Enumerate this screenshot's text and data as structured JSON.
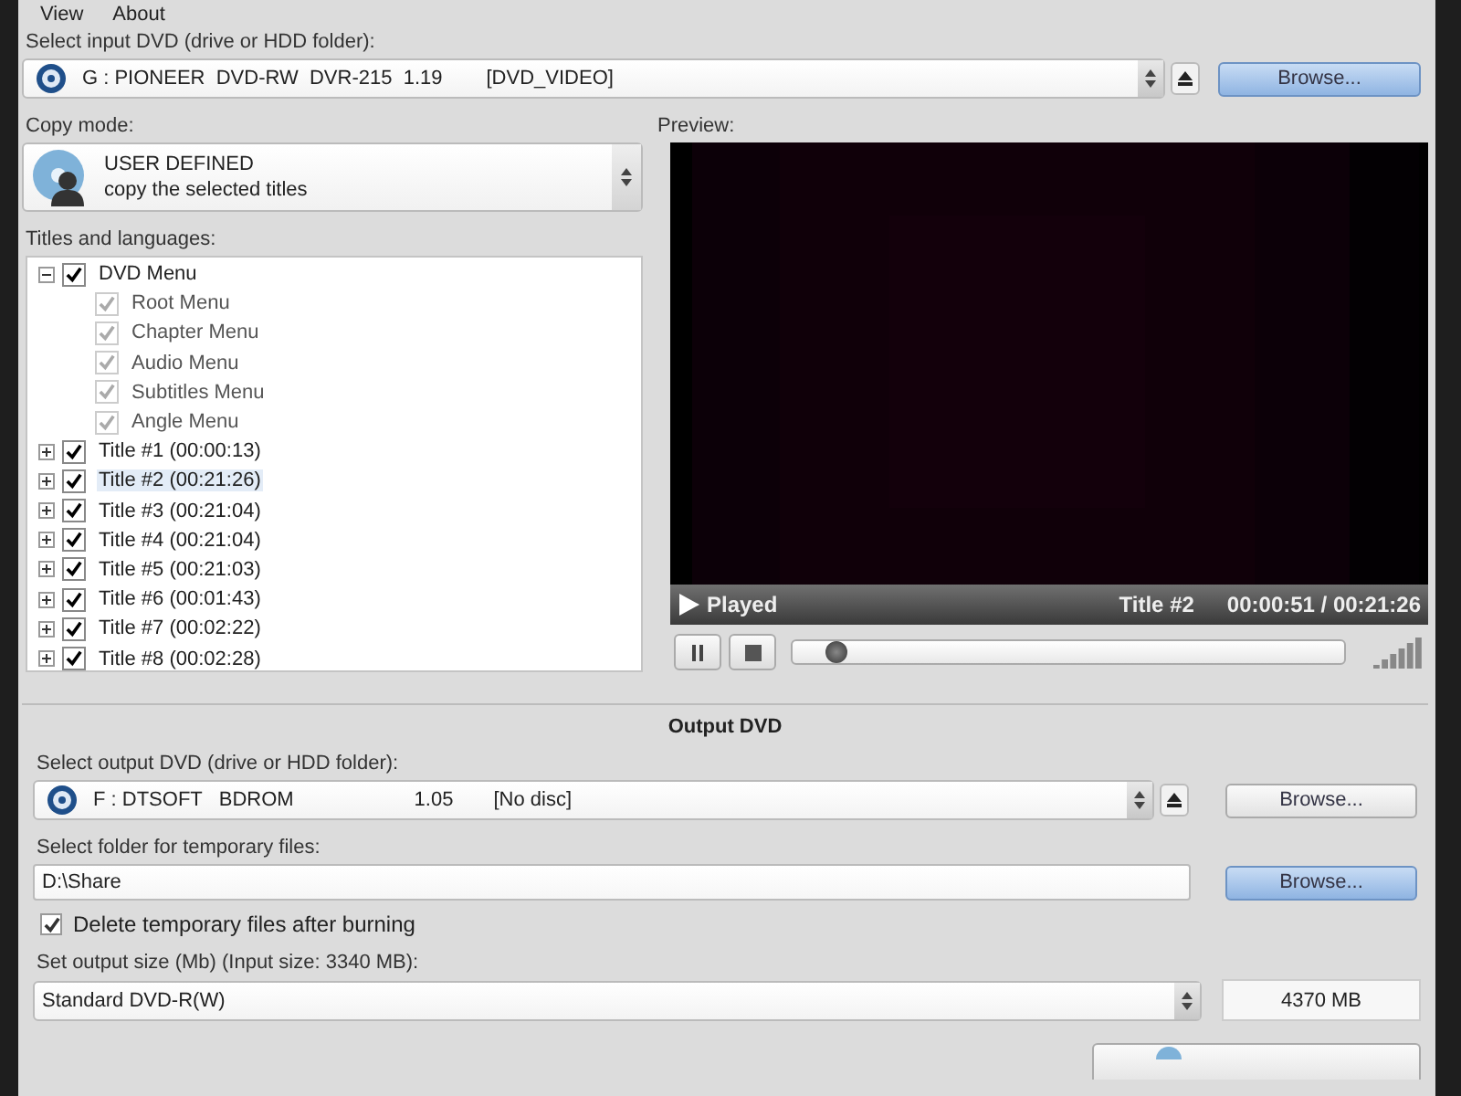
{
  "menu": [
    "View",
    "About"
  ],
  "input": {
    "label": "Select input DVD (drive or HDD folder):",
    "drive": "G : PIONEER  DVD-RW  DVR-215  1.19",
    "disc": "[DVD_VIDEO]",
    "browse": "Browse..."
  },
  "copy_mode": {
    "label": "Copy mode:",
    "title": "USER DEFINED",
    "subtitle": "copy the selected titles"
  },
  "titles": {
    "label": "Titles and languages:",
    "tree": [
      {
        "label": "DVD Menu",
        "checked": true,
        "disabled": false,
        "selected": false,
        "expanded": true,
        "children": [
          {
            "label": "Root Menu",
            "checked": true,
            "disabled": true,
            "selected": false
          },
          {
            "label": "Chapter Menu",
            "checked": true,
            "disabled": true,
            "selected": false
          },
          {
            "label": "Audio Menu",
            "checked": true,
            "disabled": true,
            "selected": false
          },
          {
            "label": "Subtitles Menu",
            "checked": true,
            "disabled": true,
            "selected": false
          },
          {
            "label": "Angle Menu",
            "checked": true,
            "disabled": true,
            "selected": false
          }
        ]
      },
      {
        "label": "Title #1 (00:00:13)",
        "checked": true,
        "disabled": false,
        "selected": false,
        "expanded": false
      },
      {
        "label": "Title #2 (00:21:26)",
        "checked": true,
        "disabled": false,
        "selected": true,
        "expanded": false
      },
      {
        "label": "Title #3 (00:21:04)",
        "checked": true,
        "disabled": false,
        "selected": false,
        "expanded": false
      },
      {
        "label": "Title #4 (00:21:04)",
        "checked": true,
        "disabled": false,
        "selected": false,
        "expanded": false
      },
      {
        "label": "Title #5 (00:21:03)",
        "checked": true,
        "disabled": false,
        "selected": false,
        "expanded": false
      },
      {
        "label": "Title #6 (00:01:43)",
        "checked": true,
        "disabled": false,
        "selected": false,
        "expanded": false
      },
      {
        "label": "Title #7 (00:02:22)",
        "checked": true,
        "disabled": false,
        "selected": false,
        "expanded": false
      },
      {
        "label": "Title #8 (00:02:28)",
        "checked": true,
        "disabled": false,
        "selected": false,
        "expanded": false
      }
    ]
  },
  "preview": {
    "label": "Preview:",
    "status": "Played",
    "title": "Title #2",
    "time": "00:00:51 / 00:21:26",
    "level": 0.06
  },
  "output": {
    "heading": "Output DVD",
    "label": "Select output DVD (drive or HDD folder):",
    "drive": "F : DTSOFT   BDROM",
    "version": "1.05",
    "disc": "[No disc]",
    "browse": "Browse...",
    "temp_label": "Select folder for temporary files:",
    "temp_value": "D:\\Share",
    "temp_browse": "Browse...",
    "delete_label": "Delete temporary files after burning",
    "delete_checked": true,
    "size_label": "Set output size (Mb) (Input size: 3340 MB):",
    "size_value": "Standard DVD-R(W)",
    "size_mb": "4370 MB"
  }
}
